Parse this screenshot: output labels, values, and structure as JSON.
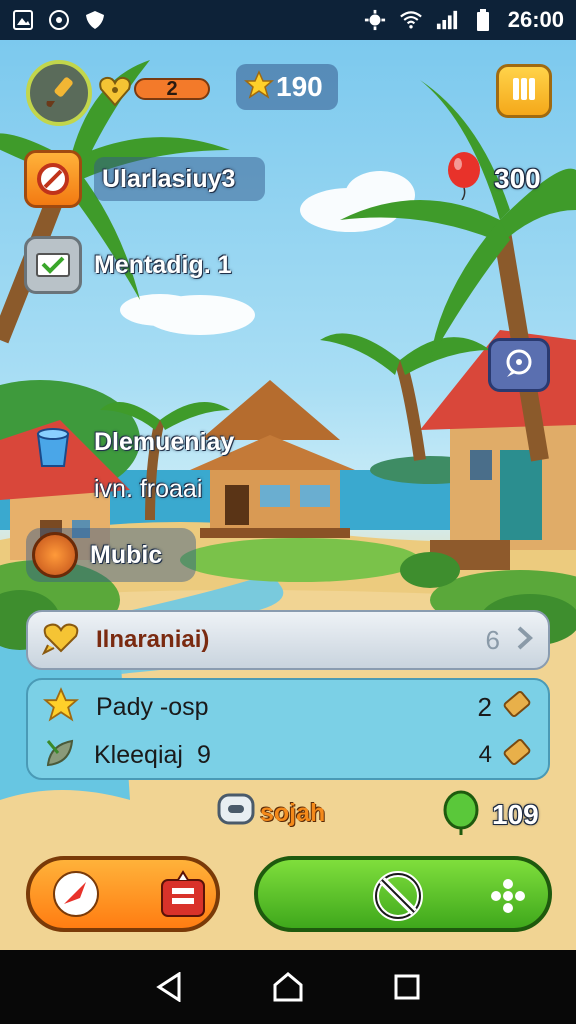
{
  "status_bar": {
    "time": "26:00",
    "icons": [
      "image-icon",
      "media-icon",
      "shield-icon",
      "settings-icon",
      "wifi-icon",
      "signal-icon",
      "battery-icon"
    ]
  },
  "hud": {
    "avatar_icon": "paintbrush-icon",
    "gems": "2",
    "stars": "190",
    "pause_icon": "pause-icon",
    "balloons": "300"
  },
  "side_menu": {
    "items": [
      {
        "label": "Ularlasiuy3",
        "icon": "target-icon"
      },
      {
        "label": "Mentadig. 1",
        "icon": "check-mail-icon"
      },
      {
        "label": "Dlemueniay",
        "sublabel": "ivn. froaai",
        "icon": "bucket-icon"
      },
      {
        "label": "Mubic",
        "icon": "coin-icon"
      }
    ]
  },
  "chat_icon": "chat-bubble-icon",
  "quest_bar": {
    "label": "Ilnaraniai)",
    "count": "6",
    "arrow": "chevron-right-icon"
  },
  "tasks": [
    {
      "label": "Pady -osp",
      "count": "2",
      "icon": "star-icon",
      "reward_icon": "ticket-icon"
    },
    {
      "label": "Kleeqiaj",
      "extra": "9",
      "count": "4",
      "icon": "leaf-icon",
      "reward_icon": "ticket-icon"
    }
  ],
  "bottom_info": {
    "chat_label": "sojah",
    "gem_count": "109"
  },
  "buttons": {
    "left_icons": [
      "rocket-icon",
      "gift-box-icon"
    ],
    "right_icons": [
      "no-entry-icon",
      "move-icon"
    ]
  },
  "nav": {
    "icons": [
      "back-icon",
      "home-icon",
      "recents-icon"
    ]
  },
  "colors": {
    "accent": "#ffb23a",
    "green": "#4cbb22",
    "panel": "#7bd0e6"
  }
}
